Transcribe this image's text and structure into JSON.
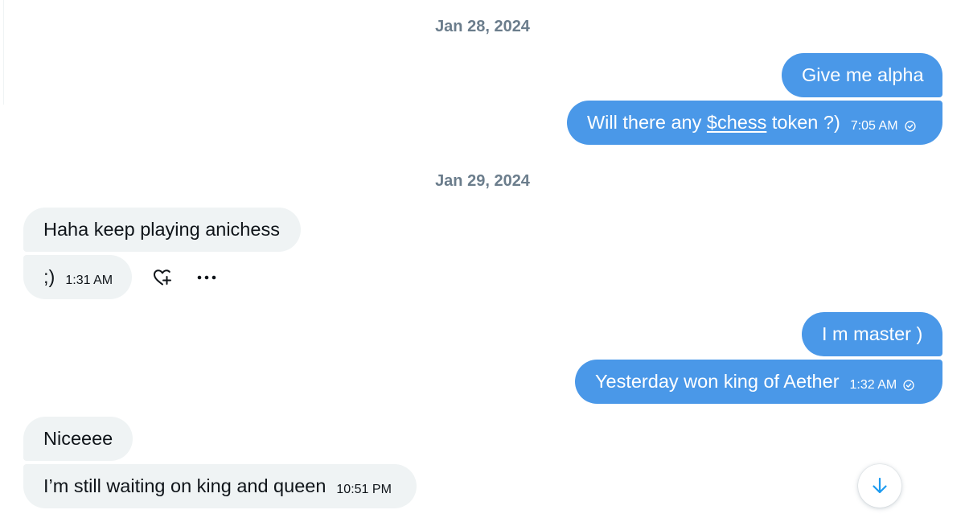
{
  "dates": {
    "first": "Jan 28, 2024",
    "second": "Jan 29, 2024"
  },
  "messages": [
    {
      "direction": "outgoing",
      "text": "Give me alpha"
    },
    {
      "direction": "outgoing",
      "text_before": "Will there any ",
      "link": "$chess",
      "text_after": " token ?)",
      "time": "7:05 AM",
      "status_icon": "check-circle-icon"
    },
    {
      "direction": "incoming",
      "text": "Haha keep playing anichess"
    },
    {
      "direction": "incoming",
      "text": ";)",
      "time": "1:31 AM"
    },
    {
      "direction": "outgoing",
      "text": "I m master )"
    },
    {
      "direction": "outgoing",
      "text": "Yesterday won king of Aether",
      "time": "1:32 AM",
      "status_icon": "check-circle-icon"
    },
    {
      "direction": "incoming",
      "text": "Niceeee"
    },
    {
      "direction": "incoming",
      "text": "I’m still waiting on king and queen",
      "time": "10:51 PM"
    }
  ],
  "message_actions": [
    "heart-plus-icon",
    "more-dots-icon"
  ],
  "scroll_button": {
    "icon": "arrow-down-icon"
  },
  "colors": {
    "outgoing_bubble": "#4a98e8",
    "incoming_bubble": "#eff3f4",
    "date_text": "#6b7d8c",
    "accent": "#1d9bf0"
  }
}
